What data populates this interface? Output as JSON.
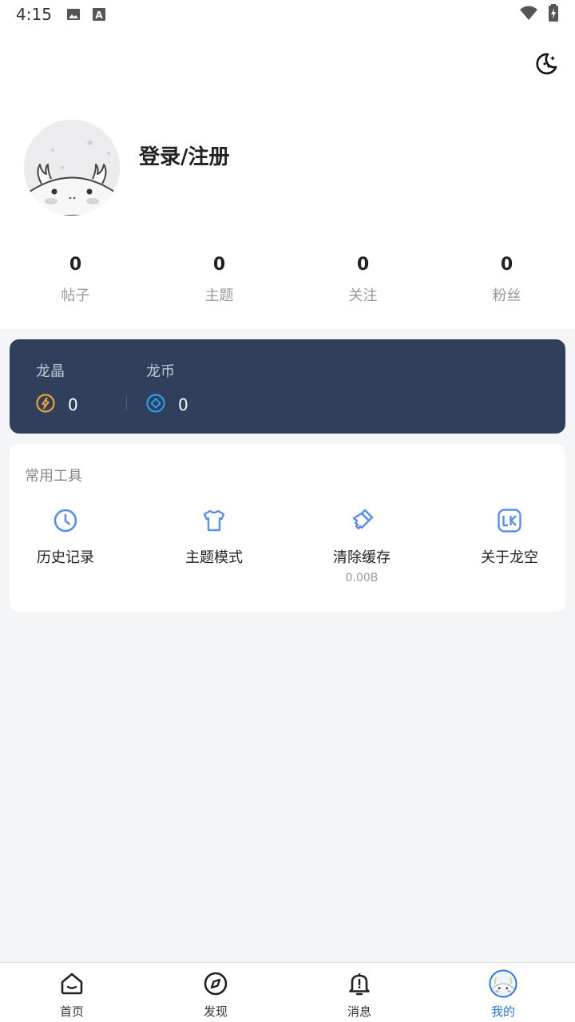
{
  "status_bar": {
    "time": "4:15",
    "icons": [
      "image-icon",
      "text-a-icon",
      "wifi-icon",
      "battery-icon"
    ]
  },
  "header": {
    "night_mode_icon": "moon-icon",
    "login_label": "登录/注册",
    "stats": [
      {
        "value": "0",
        "label": "帖子"
      },
      {
        "value": "0",
        "label": "主题"
      },
      {
        "value": "0",
        "label": "关注"
      },
      {
        "value": "0",
        "label": "粉丝"
      }
    ]
  },
  "wallet": {
    "crystal": {
      "label": "龙晶",
      "value": "0",
      "icon": "crystal-icon"
    },
    "coin": {
      "label": "龙币",
      "value": "0",
      "icon": "coin-icon"
    }
  },
  "tools": {
    "title": "常用工具",
    "items": [
      {
        "label": "历史记录",
        "icon": "clock-icon",
        "sub": ""
      },
      {
        "label": "主题模式",
        "icon": "tshirt-icon",
        "sub": ""
      },
      {
        "label": "清除缓存",
        "icon": "brush-icon",
        "sub": "0.00B"
      },
      {
        "label": "关于龙空",
        "icon": "lk-logo-icon",
        "sub": ""
      }
    ]
  },
  "bottom_nav": {
    "items": [
      {
        "label": "首页",
        "icon": "home-icon"
      },
      {
        "label": "发现",
        "icon": "compass-icon"
      },
      {
        "label": "消息",
        "icon": "bell-icon"
      },
      {
        "label": "我的",
        "icon": "avatar-icon",
        "active": true
      }
    ]
  },
  "colors": {
    "accent": "#2a72e0",
    "wallet_bg": "#30405c",
    "crystal": "#f0a030",
    "coin": "#2a9ee8",
    "tool_icon": "#5b8def"
  }
}
